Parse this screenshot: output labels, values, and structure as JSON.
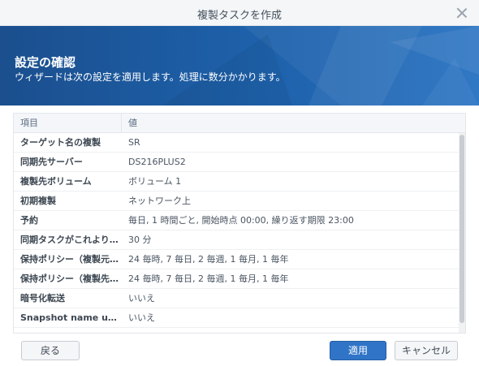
{
  "window": {
    "title": "複製タスクを作成"
  },
  "banner": {
    "title": "設定の確認",
    "subtitle": "ウィザードは次の設定を適用します。処理に数分かかります。"
  },
  "table": {
    "headers": [
      "項目",
      "値"
    ],
    "rows": [
      {
        "item": "ターゲット名の複製",
        "value": "SR"
      },
      {
        "item": "同期先サーバー",
        "value": "DS216PLUS2"
      },
      {
        "item": "複製先ボリューム",
        "value": "ボリューム 1"
      },
      {
        "item": "初期複製",
        "value": "ネットワーク上"
      },
      {
        "item": "予約",
        "value": "毎日, 1 時間ごと, 開始時点 00:00, 繰り返す期限 23:00"
      },
      {
        "item": "同期タスクがこれより長...",
        "value": "30 分"
      },
      {
        "item": "保持ポリシー（複製元サ...",
        "value": "24 毎時, 7 毎日, 2 毎週, 1 毎月, 1 毎年"
      },
      {
        "item": "保持ポリシー（複製先サ...",
        "value": "24 毎時, 7 毎日, 2 毎週, 1 毎月, 1 毎年"
      },
      {
        "item": "暗号化転送",
        "value": "いいえ"
      },
      {
        "item": "Snapshot name use...",
        "value": "いいえ"
      }
    ]
  },
  "buttons": {
    "back": "戻る",
    "apply": "適用",
    "cancel": "キャンセル"
  },
  "colors": {
    "banner": "#1d5ea6",
    "primary_button": "#2f74c6"
  }
}
